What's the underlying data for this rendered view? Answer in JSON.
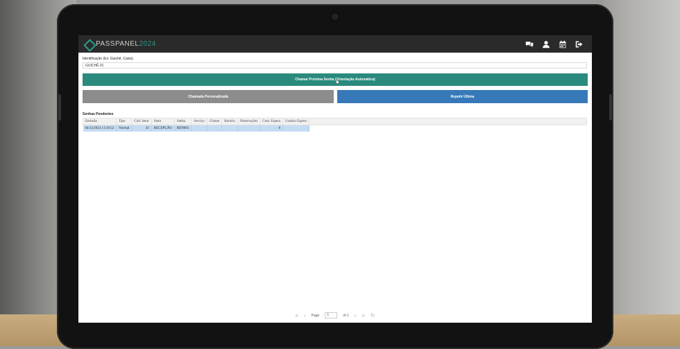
{
  "app": {
    "logo_pass": "PASS",
    "logo_panel": "PANEL",
    "logo_year": "2024"
  },
  "topbar_icons": [
    "chat-icon",
    "user-icon",
    "calendar-icon",
    "logout-icon"
  ],
  "form": {
    "label": "Identificação (Ex: Guichê, Caixa)",
    "value": "GUICHÊ 01"
  },
  "buttons": {
    "next": "Chamar Próxima Senha (Orientação Automática)",
    "custom": "Chamada Personalizada",
    "repeat": "Repetir Última"
  },
  "pending": {
    "title": "Senhas Pendentes",
    "columns": [
      "Emissão",
      "Tipo",
      "Cód. Setor",
      "Setor",
      "Senha",
      "Serviço",
      "Cliente",
      "Horário",
      "Observações",
      "Cont. Espera",
      "Usuário Espera"
    ],
    "rows": [
      {
        "emissao": "04/12/2023 11:10:52",
        "tipo": "Normal",
        "cod_setor": "43",
        "setor": "RECEPÇÃO",
        "senha": "REN003",
        "servico": "",
        "cliente": "",
        "horario": "",
        "observacoes": "",
        "cont_espera": "0",
        "usuario_espera": ""
      }
    ]
  },
  "pager": {
    "page_label": "Page",
    "page_value": "1",
    "of_label": "of 1"
  },
  "colors": {
    "teal": "#2a8a7d",
    "grey": "#8c8c8c",
    "blue": "#3779b8",
    "topbar": "#2a2a2a",
    "selected_row": "#c4dcf2"
  }
}
